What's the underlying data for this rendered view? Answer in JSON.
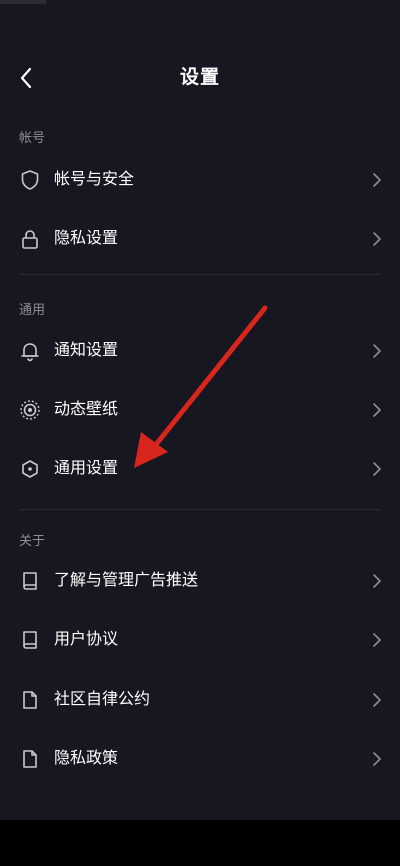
{
  "header": {
    "title": "设置"
  },
  "sections": [
    {
      "title": "帐号",
      "items": [
        {
          "label": "帐号与安全",
          "icon": "shield-icon"
        },
        {
          "label": "隐私设置",
          "icon": "lock-icon"
        }
      ]
    },
    {
      "title": "通用",
      "items": [
        {
          "label": "通知设置",
          "icon": "bell-icon"
        },
        {
          "label": "动态壁纸",
          "icon": "wallpaper-icon"
        },
        {
          "label": "通用设置",
          "icon": "hexagon-icon"
        }
      ]
    },
    {
      "title": "关于",
      "items": [
        {
          "label": "了解与管理广告推送",
          "icon": "book-icon"
        },
        {
          "label": "用户协议",
          "icon": "book-icon"
        },
        {
          "label": "社区自律公约",
          "icon": "document-icon"
        },
        {
          "label": "隐私政策",
          "icon": "document-icon"
        }
      ]
    }
  ],
  "colors": {
    "background": "#161720",
    "text": "#ffffff",
    "section_header": "#8c8d96",
    "icon": "#c8c9d0",
    "chevron": "#8c8d96",
    "annotation_arrow": "#d9261c"
  }
}
